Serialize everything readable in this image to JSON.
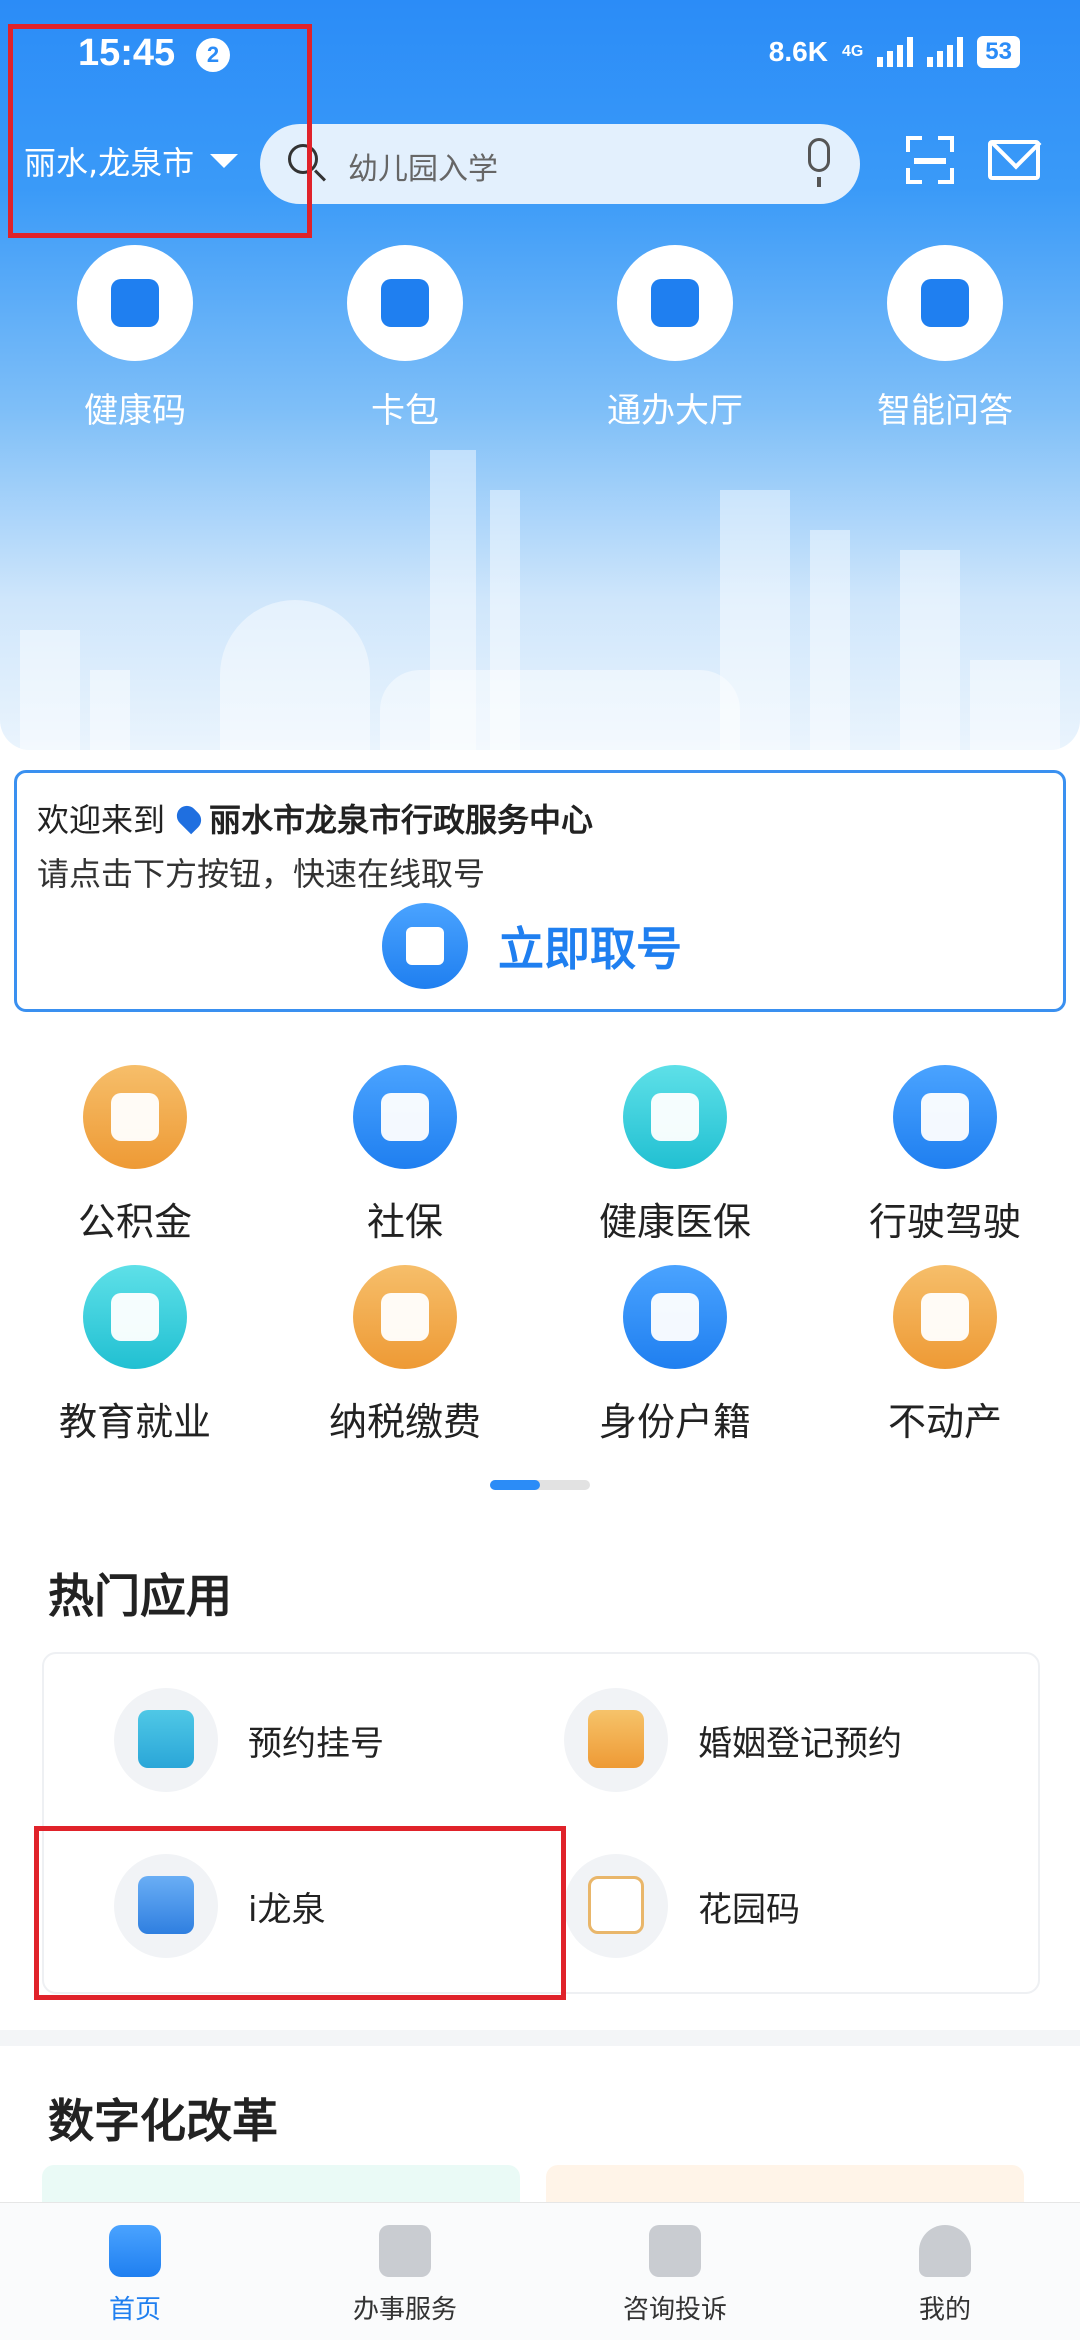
{
  "status_bar": {
    "time": "15:45",
    "notification_count": "2",
    "net_speed": "8.6K",
    "network": "4G",
    "battery": "53"
  },
  "header": {
    "city": "丽水,龙泉市",
    "search_placeholder": "幼儿园入学"
  },
  "quick_actions": [
    {
      "label": "健康码",
      "icon": "health-code-icon"
    },
    {
      "label": "卡包",
      "icon": "card-wallet-icon"
    },
    {
      "label": "通办大厅",
      "icon": "service-hall-icon"
    },
    {
      "label": "智能问答",
      "icon": "robot-icon"
    }
  ],
  "welcome": {
    "prefix": "欢迎来到",
    "place": "丽水市龙泉市行政服务中心",
    "hint": "请点击下方按钮，快速在线取号",
    "button": "立即取号"
  },
  "services": [
    {
      "label": "公积金",
      "icon": "housing-fund-icon",
      "color": "orange"
    },
    {
      "label": "社保",
      "icon": "social-security-icon",
      "color": "blue"
    },
    {
      "label": "健康医保",
      "icon": "medical-insurance-icon",
      "color": "teal"
    },
    {
      "label": "行驶驾驶",
      "icon": "driving-icon",
      "color": "blue"
    },
    {
      "label": "教育就业",
      "icon": "education-icon",
      "color": "teal"
    },
    {
      "label": "纳税缴费",
      "icon": "tax-icon",
      "color": "orange"
    },
    {
      "label": "身份户籍",
      "icon": "identity-icon",
      "color": "blue"
    },
    {
      "label": "不动产",
      "icon": "real-estate-icon",
      "color": "orange"
    }
  ],
  "hot_apps": {
    "title": "热门应用",
    "items": [
      {
        "label": "预约挂号",
        "icon": "appointment-icon"
      },
      {
        "label": "婚姻登记预约",
        "icon": "marriage-icon"
      },
      {
        "label": "i龙泉",
        "icon": "ilongquan-icon"
      },
      {
        "label": "花园码",
        "icon": "garden-code-icon"
      }
    ]
  },
  "digital_reform": {
    "title": "数字化改革"
  },
  "bottom_nav": [
    {
      "label": "首页",
      "active": true
    },
    {
      "label": "办事服务",
      "active": false
    },
    {
      "label": "咨询投诉",
      "active": false
    },
    {
      "label": "我的",
      "active": false
    }
  ],
  "colors": {
    "primary": "#1f7ff0",
    "highlight": "#e0222a"
  }
}
